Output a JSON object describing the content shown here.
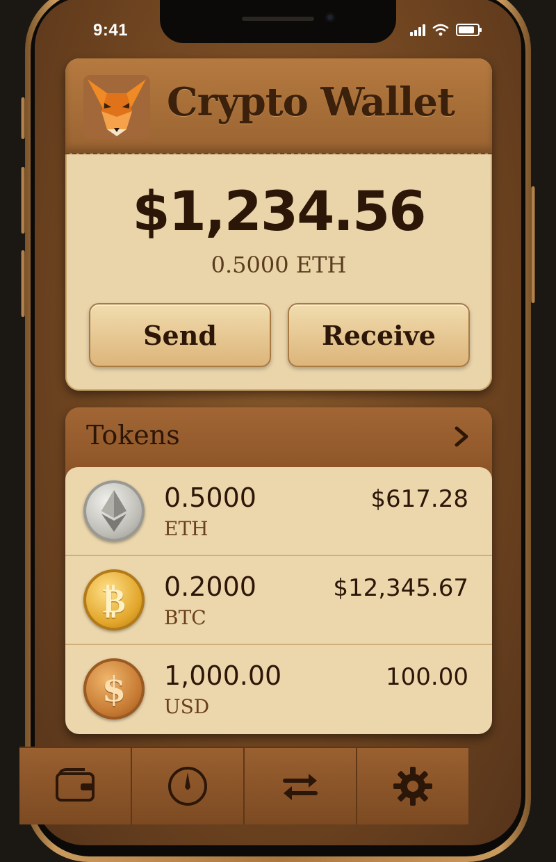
{
  "status_bar": {
    "time": "9:41"
  },
  "header": {
    "title": "Crypto Wallet",
    "logo_icon": "fox-icon"
  },
  "balance": {
    "usd": "$1,234.56",
    "eth": "0.5000 ETH"
  },
  "actions": {
    "send_label": "Send",
    "receive_label": "Receive"
  },
  "tokens": {
    "title": "Tokens",
    "items": [
      {
        "amount": "0.5000",
        "symbol": "ETH",
        "value": "$617.28",
        "icon": "ethereum-icon"
      },
      {
        "amount": "0.2000",
        "symbol": "BTC",
        "value": "$12,345.67",
        "icon": "bitcoin-icon"
      },
      {
        "amount": "1,000.00",
        "symbol": "USD",
        "value": "100.00",
        "icon": "dollar-icon"
      }
    ]
  },
  "tabs": [
    {
      "icon": "wallet-icon"
    },
    {
      "icon": "compass-icon"
    },
    {
      "icon": "swap-icon"
    },
    {
      "icon": "gear-icon"
    }
  ],
  "colors": {
    "leather": "#8b5529",
    "parchment": "#ecd7ad",
    "ink": "#2c1608"
  }
}
